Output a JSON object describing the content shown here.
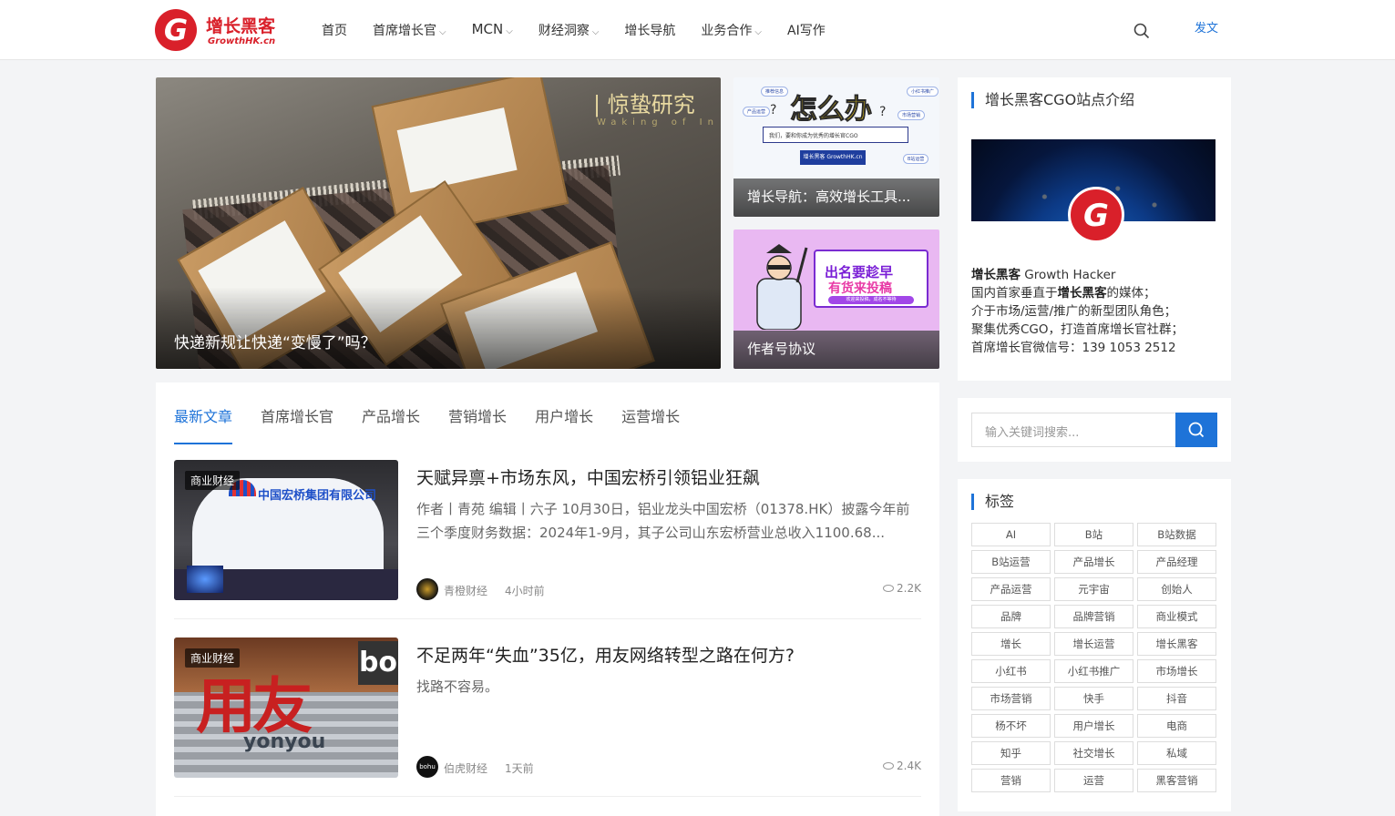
{
  "header": {
    "logo_cn": "增长黑客",
    "logo_en": "GrowthHK.cn",
    "logo_mark": "G",
    "nav": [
      {
        "label": "首页",
        "dropdown": false
      },
      {
        "label": "首席增长官",
        "dropdown": true
      },
      {
        "label": "MCN",
        "dropdown": true
      },
      {
        "label": "财经洞察",
        "dropdown": true
      },
      {
        "label": "增长导航",
        "dropdown": false
      },
      {
        "label": "业务合作",
        "dropdown": true
      },
      {
        "label": "AI写作",
        "dropdown": false
      }
    ],
    "post_label": "发文"
  },
  "hero": {
    "main_title": "快递新规让快递“变慢了”吗？",
    "main_tag": "| 惊蛰研究",
    "main_tag_sub": "Waking of In",
    "side": [
      {
        "title": "增长导航：高效增长工具...",
        "art_heading": "怎么办",
        "art_search": "我们，要和你成为优秀的增长官CGO",
        "art_button": "增长黑客 GrowthHK.cn",
        "art_chips": [
          "推荐信息",
          "产品运营",
          "小红书推广",
          "市场营销",
          "B站运营"
        ]
      },
      {
        "title": "作者号协议",
        "art_line1": "出名要趁早",
        "art_line2": "有货来投稿",
        "art_line3": "欢迎来投稿，成名不等待"
      }
    ]
  },
  "tabs": [
    "最新文章",
    "首席增长官",
    "产品增长",
    "营销增长",
    "用户增长",
    "运营增长"
  ],
  "active_tab": 0,
  "articles": [
    {
      "category": "商业财经",
      "title": "天赋异禀+市场东风，中国宏桥引领铝业狂飙",
      "excerpt": "作者丨青苑 编辑丨六子 10月30日，铝业龙头中国宏桥（01378.HK）披露今年前三个季度财务数据：2024年1-9月，其子公司山东宏桥营业总收入1100.68...",
      "author": "青橙财经",
      "time": "4小时前",
      "views": "2.2K",
      "thumb_text": "中国宏桥集团有限公司"
    },
    {
      "category": "商业财经",
      "title": "不足两年“失血”35亿，用友网络转型之路在何方?",
      "excerpt": "找路不容易。",
      "author": "伯虎财经",
      "time": "1天前",
      "views": "2.4K",
      "thumb_text": "用友",
      "thumb_sub": "yonyou",
      "thumb_bo": "bo",
      "avatar_text": "bohu"
    }
  ],
  "sidebar": {
    "intro_title": "增长黑客CGO站点介绍",
    "intro_lines": {
      "l1_bold": "增长黑客",
      "l1_rest": " Growth Hacker",
      "l2_pre": "国内首家垂直于",
      "l2_bold": "增长黑客",
      "l2_post": "的媒体；",
      "l3": "介于市场/运营/推广的新型团队角色；",
      "l4": "聚集优秀CGO，打造首席增长官社群；",
      "l5": "首席增长官微信号：139 1053 2512"
    },
    "search_placeholder": "输入关键词搜索...",
    "tags_title": "标签",
    "tags": [
      "AI",
      "B站",
      "B站数据",
      "B站运营",
      "产品增长",
      "产品经理",
      "产品运营",
      "元宇宙",
      "创始人",
      "品牌",
      "品牌营销",
      "商业模式",
      "增长",
      "增长运营",
      "增长黑客",
      "小红书",
      "小红书推广",
      "市场增长",
      "市场营销",
      "快手",
      "抖音",
      "杨不坏",
      "用户增长",
      "电商",
      "知乎",
      "社交增长",
      "私域",
      "营销",
      "运营",
      "黑客营销"
    ]
  },
  "colors": {
    "accent": "#1e73d8",
    "brand": "#d9202a"
  }
}
